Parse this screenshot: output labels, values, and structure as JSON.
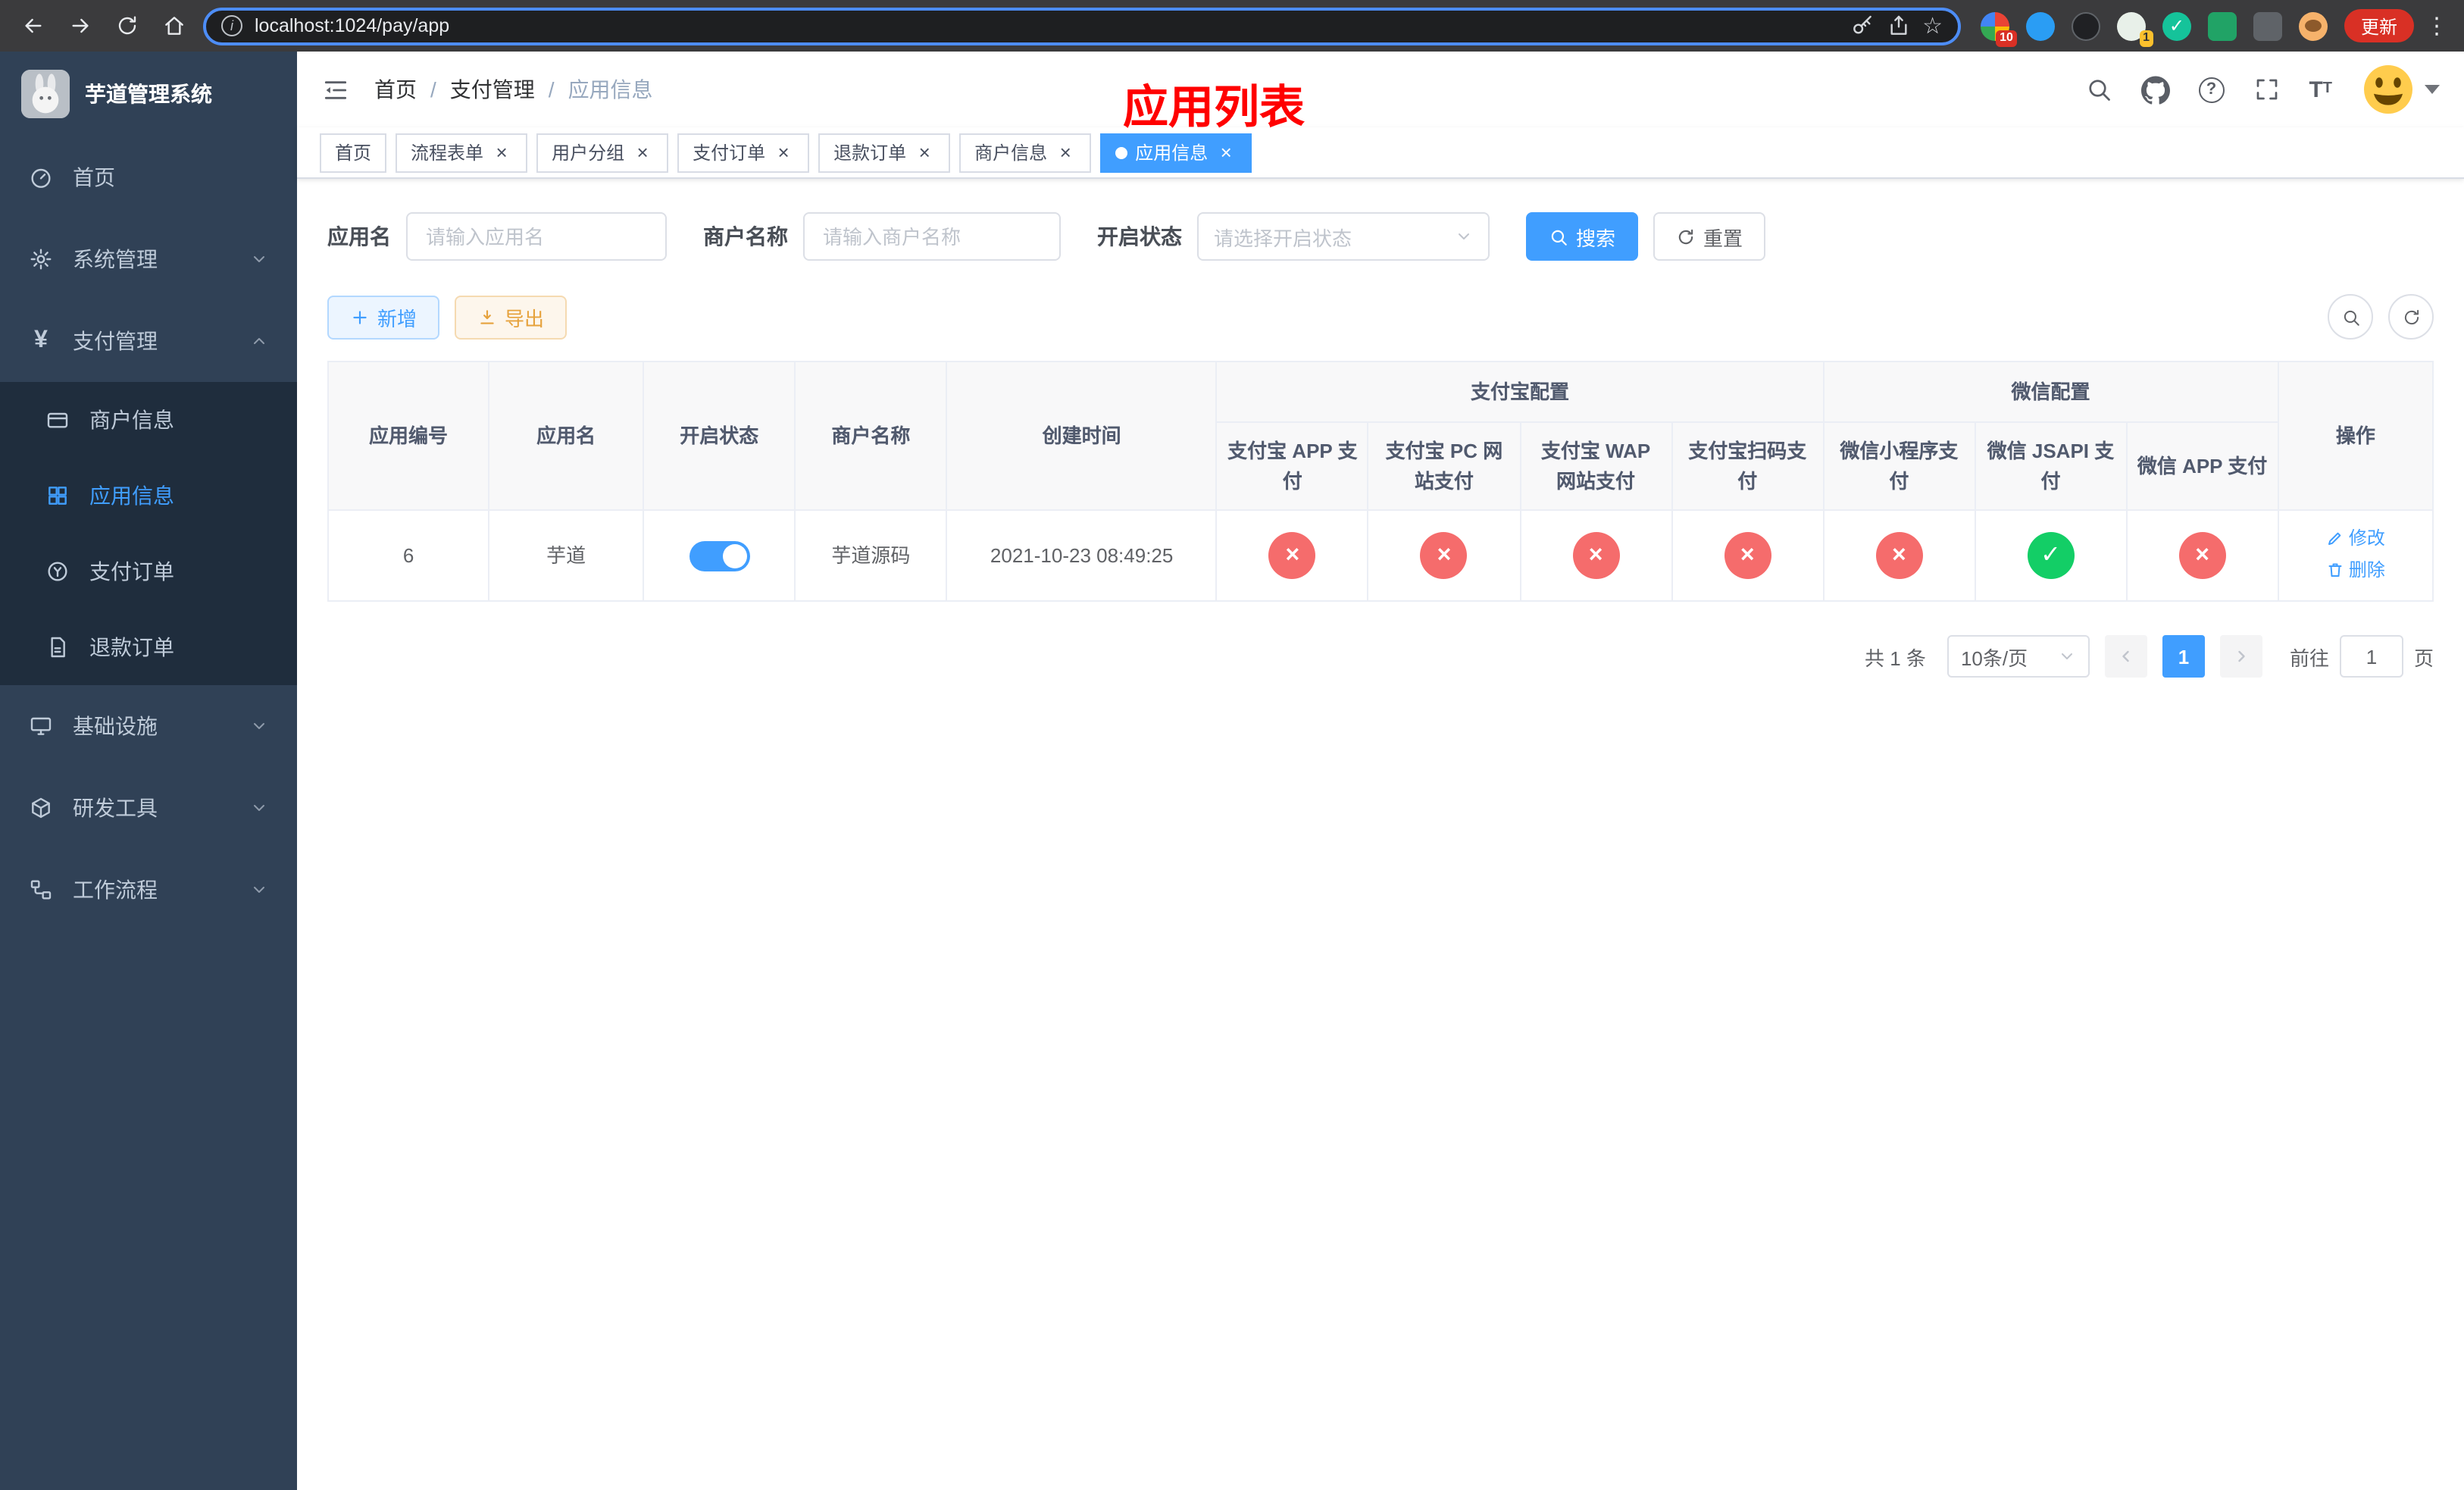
{
  "colors": {
    "primary": "#409eff",
    "success": "#13ce66",
    "danger": "#f56c6c",
    "warning": "#e6a23c",
    "page-red": "#ff0000",
    "sidebar-bg": "#304156",
    "sidebar-sub-bg": "#1f2d3d"
  },
  "icons": {
    "close": "×",
    "yes": "✓",
    "no": "×",
    "star": "☆",
    "dots": "⋮",
    "info": "i",
    "yen": "¥",
    "fontsize_big": "T",
    "fontsize_small": "T"
  },
  "browser": {
    "url": "localhost:1024/pay/app",
    "update_label": "更新",
    "extension_badges": {
      "first": "10",
      "fourth": "1"
    }
  },
  "sidebar": {
    "title": "芋道管理系统",
    "items": [
      {
        "label": "首页"
      },
      {
        "label": "系统管理"
      },
      {
        "label": "支付管理"
      },
      {
        "label": "基础设施"
      },
      {
        "label": "研发工具"
      },
      {
        "label": "工作流程"
      }
    ],
    "pay_submenu": [
      {
        "label": "商户信息"
      },
      {
        "label": "应用信息"
      },
      {
        "label": "支付订单"
      },
      {
        "label": "退款订单"
      }
    ]
  },
  "header": {
    "breadcrumb": {
      "items": [
        "首页",
        "支付管理",
        "应用信息"
      ],
      "separator": "/"
    },
    "page_title": "应用列表"
  },
  "tabs": [
    {
      "label": "首页"
    },
    {
      "label": "流程表单"
    },
    {
      "label": "用户分组"
    },
    {
      "label": "支付订单"
    },
    {
      "label": "退款订单"
    },
    {
      "label": "商户信息"
    },
    {
      "label": "应用信息"
    }
  ],
  "filters": {
    "app_name": {
      "label": "应用名",
      "placeholder": "请输入应用名"
    },
    "merchant_name": {
      "label": "商户名称",
      "placeholder": "请输入商户名称"
    },
    "status": {
      "label": "开启状态",
      "placeholder": "请选择开启状态"
    },
    "search_button": "搜索",
    "reset_button": "重置"
  },
  "toolbar": {
    "add_button": "新增",
    "export_button": "导出"
  },
  "table": {
    "fixed_columns": [
      "应用编号",
      "应用名",
      "开启状态",
      "商户名称",
      "创建时间"
    ],
    "group_columns": [
      "支付宝配置",
      "微信配置"
    ],
    "sub_columns": [
      "支付宝 APP 支付",
      "支付宝 PC 网站支付",
      "支付宝 WAP 网站支付",
      "支付宝扫码支付",
      "微信小程序支付",
      "微信 JSAPI 支付",
      "微信 APP 支付"
    ],
    "actions_column": "操作",
    "rows": [
      {
        "id": "6",
        "name": "芋道",
        "enabled": true,
        "merchant": "芋道源码",
        "created": "2021-10-23 08:49:25",
        "configs": [
          "no",
          "no",
          "no",
          "no",
          "no",
          "yes",
          "no"
        ],
        "actions": {
          "edit": "修改",
          "delete": "删除"
        }
      }
    ]
  },
  "pagination": {
    "total": "共 1 条",
    "page_size": "10条/页",
    "current_page": "1",
    "goto_prefix": "前往",
    "goto_value": "1",
    "goto_suffix": "页"
  }
}
